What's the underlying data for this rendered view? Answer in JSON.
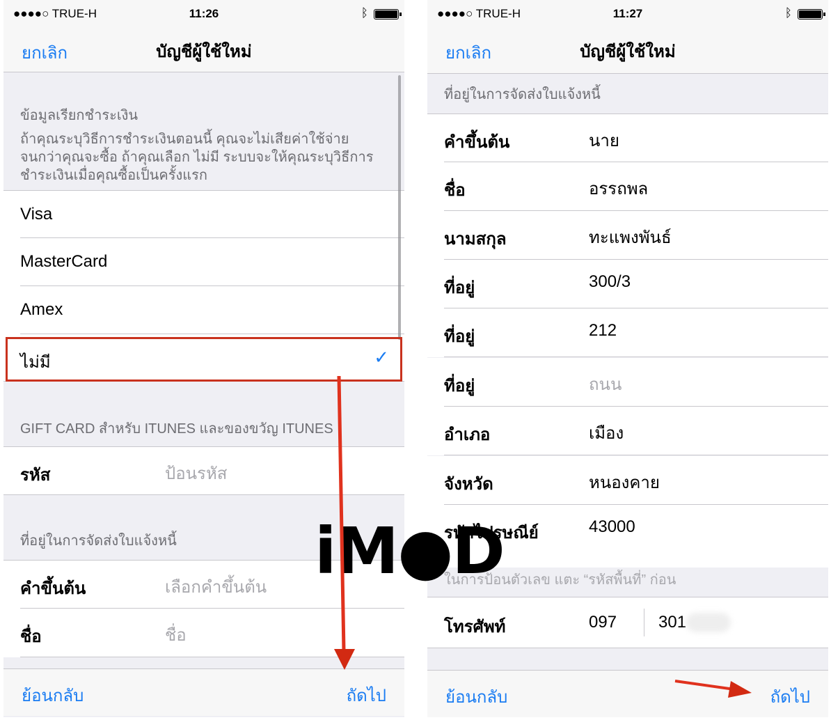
{
  "left": {
    "status": {
      "carrier": "●●●●○ TRUE-H",
      "time": "11:26"
    },
    "nav": {
      "cancel": "ยกเลิก",
      "title": "บัญชีผู้ใช้ใหม่"
    },
    "billing": {
      "header": "ข้อมูลเรียกชำระเงิน",
      "note": "ถ้าคุณระบุวิธีการชำระเงินตอนนี้ คุณจะไม่เสียค่าใช้จ่าย จนกว่าคุณจะซื้อ ถ้าคุณเลือก ไม่มี ระบบจะให้คุณระบุวิธีการชำระเงินเมื่อคุณซื้อเป็นครั้งแรก",
      "options": [
        {
          "label": "Visa"
        },
        {
          "label": "MasterCard"
        },
        {
          "label": "Amex"
        },
        {
          "label": "ไม่มี",
          "selected": true
        }
      ]
    },
    "gift": {
      "header": "GIFT CARD สำหรับ ITUNES และของขวัญ ITUNES",
      "code_label": "รหัส",
      "code_placeholder": "ป้อนรหัส"
    },
    "address": {
      "header": "ที่อยู่ในการจัดส่งใบแจ้งหนี้",
      "rows": [
        {
          "label": "คำขึ้นต้น",
          "placeholder": "เลือกคำขึ้นต้น"
        },
        {
          "label": "ชื่อ",
          "placeholder": "ชื่อ"
        }
      ]
    },
    "toolbar": {
      "back": "ย้อนกลับ",
      "next": "ถัดไป"
    }
  },
  "right": {
    "status": {
      "carrier": "●●●●○ TRUE-H",
      "time": "11:27"
    },
    "nav": {
      "cancel": "ยกเลิก",
      "title": "บัญชีผู้ใช้ใหม่"
    },
    "header": "ที่อยู่ในการจัดส่งใบแจ้งหนี้",
    "rows": [
      {
        "label": "คำขึ้นต้น",
        "value": "นาย"
      },
      {
        "label": "ชื่อ",
        "value": "อรรถพล"
      },
      {
        "label": "นามสกุล",
        "value": "ทะแพงพันธ์"
      },
      {
        "label": "ที่อยู่",
        "value": "300/3"
      },
      {
        "label": "ที่อยู่",
        "value": "212"
      },
      {
        "label": "ที่อยู่",
        "placeholder": "ถนน"
      },
      {
        "label": "อำเภอ",
        "value": "เมือง"
      },
      {
        "label": "จังหวัด",
        "value": "หนองคาย"
      },
      {
        "label": "รหัสไปรษณีย์",
        "value": "43000"
      }
    ],
    "phone_note": "ในการป้อนตัวเลข แตะ “รหัสพื้นที่” ก่อน",
    "phone": {
      "label": "โทรศัพท์",
      "area_code": "097",
      "number": "301"
    },
    "toolbar": {
      "back": "ย้อนกลับ",
      "next": "ถัดไป"
    }
  },
  "watermark": "iMOD",
  "colors": {
    "accent": "#1a7cf2",
    "highlight": "#c9321e",
    "arrow": "#e0321e"
  }
}
